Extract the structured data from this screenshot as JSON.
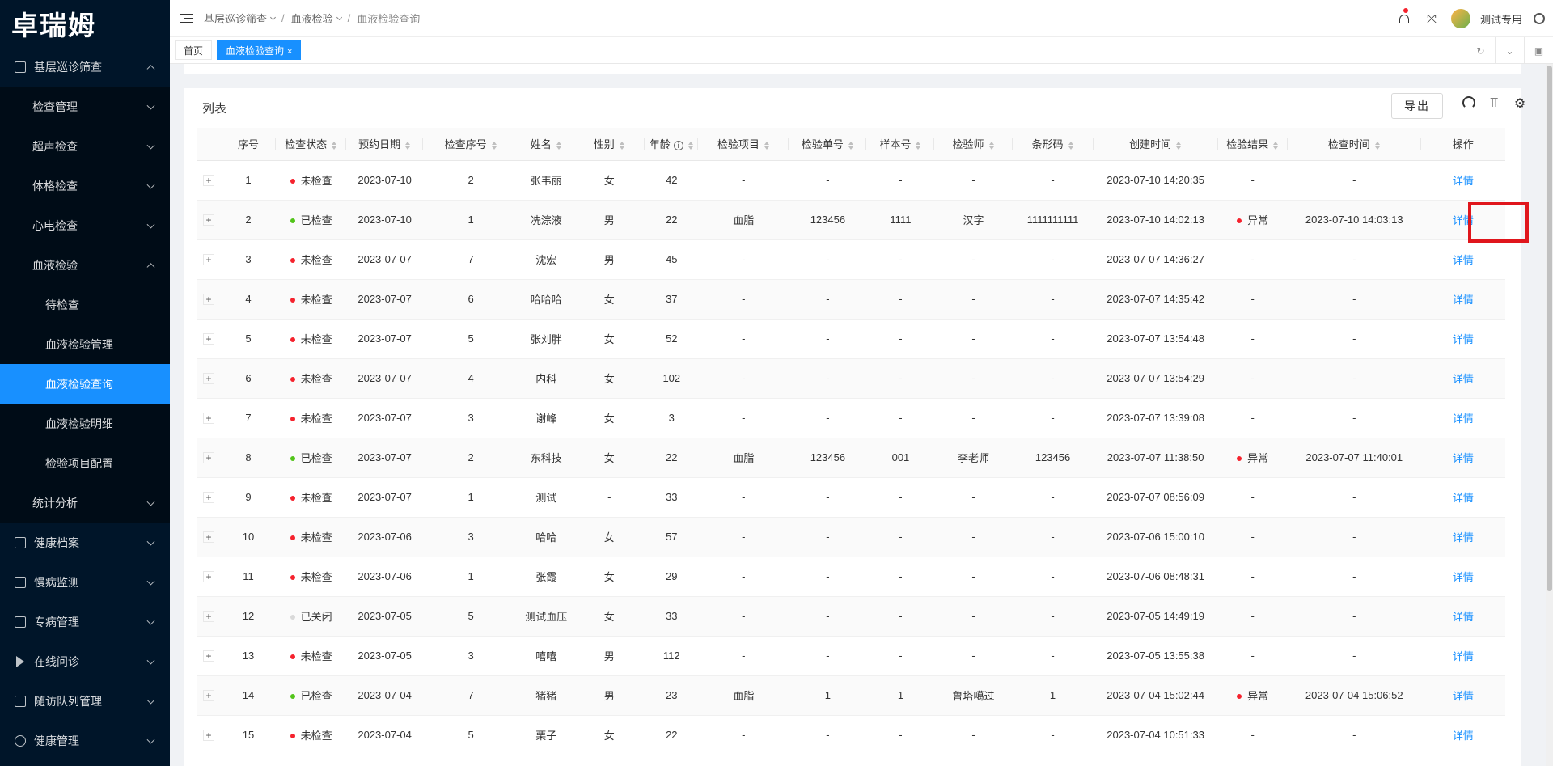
{
  "app": {
    "logo": "卓瑞姆"
  },
  "sidebar": {
    "items": [
      {
        "label": "基层巡诊筛查",
        "level": "top",
        "expanded": true,
        "icon": "dashboard-icon"
      },
      {
        "label": "检查管理",
        "level": "sub",
        "expanded": false
      },
      {
        "label": "超声检查",
        "level": "sub",
        "expanded": false
      },
      {
        "label": "体格检查",
        "level": "sub",
        "expanded": false
      },
      {
        "label": "心电检查",
        "level": "sub",
        "expanded": false
      },
      {
        "label": "血液检验",
        "level": "sub",
        "expanded": true
      },
      {
        "label": "待检查",
        "level": "sub2"
      },
      {
        "label": "血液检验管理",
        "level": "sub2"
      },
      {
        "label": "血液检验查询",
        "level": "sub2",
        "active": true
      },
      {
        "label": "血液检验明细",
        "level": "sub2"
      },
      {
        "label": "检验项目配置",
        "level": "sub2"
      },
      {
        "label": "统计分析",
        "level": "sub",
        "expanded": false
      },
      {
        "label": "健康档案",
        "level": "top",
        "expanded": false,
        "icon": "profile-icon"
      },
      {
        "label": "慢病监测",
        "level": "top",
        "expanded": false,
        "icon": "monitor-icon"
      },
      {
        "label": "专病管理",
        "level": "top",
        "expanded": false,
        "icon": "disease-icon"
      },
      {
        "label": "在线问诊",
        "level": "top",
        "expanded": false,
        "icon": "send-icon"
      },
      {
        "label": "随访队列管理",
        "level": "top",
        "expanded": false,
        "icon": "queue-icon"
      },
      {
        "label": "健康管理",
        "level": "top",
        "expanded": false,
        "icon": "shield-icon"
      }
    ]
  },
  "header": {
    "breadcrumb": [
      "基层巡诊筛查",
      "血液检验",
      "血液检验查询"
    ],
    "username": "测试专用"
  },
  "tabs": [
    {
      "label": "首页",
      "active": false
    },
    {
      "label": "血液检验查询",
      "active": true,
      "close": "×"
    }
  ],
  "list": {
    "title": "列表",
    "export_label": "导出",
    "columns": [
      "",
      "序号",
      "检查状态",
      "预约日期",
      "检查序号",
      "姓名",
      "性别",
      "年龄",
      "检验项目",
      "检验单号",
      "样本号",
      "检验师",
      "条形码",
      "创建时间",
      "检验结果",
      "检查时间",
      "操作"
    ],
    "expand_symbol": "+",
    "action_label": "详情",
    "rows": [
      {
        "no": "1",
        "status": "未检查",
        "status_color": "#f5222d",
        "date": "2023-07-10",
        "seq": "2",
        "name": "张韦丽",
        "sex": "女",
        "age": "42",
        "item": "-",
        "order": "-",
        "sample": "-",
        "tech": "-",
        "barcode": "-",
        "created": "2023-07-10 14:20:35",
        "result": "-",
        "result_color": "",
        "checked": "-"
      },
      {
        "no": "2",
        "status": "已检查",
        "status_color": "#52c41a",
        "date": "2023-07-10",
        "seq": "1",
        "name": "冼淙液",
        "sex": "男",
        "age": "22",
        "item": "血脂",
        "order": "123456",
        "sample": "1111",
        "tech": "汉字",
        "barcode": "1111111111",
        "created": "2023-07-10 14:02:13",
        "result": "异常",
        "result_color": "#f5222d",
        "checked": "2023-07-10 14:03:13"
      },
      {
        "no": "3",
        "status": "未检查",
        "status_color": "#f5222d",
        "date": "2023-07-07",
        "seq": "7",
        "name": "沈宏",
        "sex": "男",
        "age": "45",
        "item": "-",
        "order": "-",
        "sample": "-",
        "tech": "-",
        "barcode": "-",
        "created": "2023-07-07 14:36:27",
        "result": "-",
        "result_color": "",
        "checked": "-"
      },
      {
        "no": "4",
        "status": "未检查",
        "status_color": "#f5222d",
        "date": "2023-07-07",
        "seq": "6",
        "name": "哈哈哈",
        "sex": "女",
        "age": "37",
        "item": "-",
        "order": "-",
        "sample": "-",
        "tech": "-",
        "barcode": "-",
        "created": "2023-07-07 14:35:42",
        "result": "-",
        "result_color": "",
        "checked": "-"
      },
      {
        "no": "5",
        "status": "未检查",
        "status_color": "#f5222d",
        "date": "2023-07-07",
        "seq": "5",
        "name": "张刘胖",
        "sex": "女",
        "age": "52",
        "item": "-",
        "order": "-",
        "sample": "-",
        "tech": "-",
        "barcode": "-",
        "created": "2023-07-07 13:54:48",
        "result": "-",
        "result_color": "",
        "checked": "-"
      },
      {
        "no": "6",
        "status": "未检查",
        "status_color": "#f5222d",
        "date": "2023-07-07",
        "seq": "4",
        "name": "内科",
        "sex": "女",
        "age": "102",
        "item": "-",
        "order": "-",
        "sample": "-",
        "tech": "-",
        "barcode": "-",
        "created": "2023-07-07 13:54:29",
        "result": "-",
        "result_color": "",
        "checked": "-"
      },
      {
        "no": "7",
        "status": "未检查",
        "status_color": "#f5222d",
        "date": "2023-07-07",
        "seq": "3",
        "name": "谢峰",
        "sex": "女",
        "age": "3",
        "item": "-",
        "order": "-",
        "sample": "-",
        "tech": "-",
        "barcode": "-",
        "created": "2023-07-07 13:39:08",
        "result": "-",
        "result_color": "",
        "checked": "-"
      },
      {
        "no": "8",
        "status": "已检查",
        "status_color": "#52c41a",
        "date": "2023-07-07",
        "seq": "2",
        "name": "东科技",
        "sex": "女",
        "age": "22",
        "item": "血脂",
        "order": "123456",
        "sample": "001",
        "tech": "李老师",
        "barcode": "123456",
        "created": "2023-07-07 11:38:50",
        "result": "异常",
        "result_color": "#f5222d",
        "checked": "2023-07-07 11:40:01"
      },
      {
        "no": "9",
        "status": "未检查",
        "status_color": "#f5222d",
        "date": "2023-07-07",
        "seq": "1",
        "name": "测试",
        "sex": "-",
        "age": "33",
        "item": "-",
        "order": "-",
        "sample": "-",
        "tech": "-",
        "barcode": "-",
        "created": "2023-07-07 08:56:09",
        "result": "-",
        "result_color": "",
        "checked": "-"
      },
      {
        "no": "10",
        "status": "未检查",
        "status_color": "#f5222d",
        "date": "2023-07-06",
        "seq": "3",
        "name": "哈哈",
        "sex": "女",
        "age": "57",
        "item": "-",
        "order": "-",
        "sample": "-",
        "tech": "-",
        "barcode": "-",
        "created": "2023-07-06 15:00:10",
        "result": "-",
        "result_color": "",
        "checked": "-"
      },
      {
        "no": "11",
        "status": "未检查",
        "status_color": "#f5222d",
        "date": "2023-07-06",
        "seq": "1",
        "name": "张霞",
        "sex": "女",
        "age": "29",
        "item": "-",
        "order": "-",
        "sample": "-",
        "tech": "-",
        "barcode": "-",
        "created": "2023-07-06 08:48:31",
        "result": "-",
        "result_color": "",
        "checked": "-"
      },
      {
        "no": "12",
        "status": "已关闭",
        "status_color": "#d9d9d9",
        "date": "2023-07-05",
        "seq": "5",
        "name": "测试血压",
        "sex": "女",
        "age": "33",
        "item": "-",
        "order": "-",
        "sample": "-",
        "tech": "-",
        "barcode": "-",
        "created": "2023-07-05 14:49:19",
        "result": "-",
        "result_color": "",
        "checked": "-"
      },
      {
        "no": "13",
        "status": "未检查",
        "status_color": "#f5222d",
        "date": "2023-07-05",
        "seq": "3",
        "name": "嘻嘻",
        "sex": "男",
        "age": "112",
        "item": "-",
        "order": "-",
        "sample": "-",
        "tech": "-",
        "barcode": "-",
        "created": "2023-07-05 13:55:38",
        "result": "-",
        "result_color": "",
        "checked": "-"
      },
      {
        "no": "14",
        "status": "已检查",
        "status_color": "#52c41a",
        "date": "2023-07-04",
        "seq": "7",
        "name": "猪猪",
        "sex": "男",
        "age": "23",
        "item": "血脂",
        "order": "1",
        "sample": "1",
        "tech": "鲁塔噶过",
        "barcode": "1",
        "created": "2023-07-04 15:02:44",
        "result": "异常",
        "result_color": "#f5222d",
        "checked": "2023-07-04 15:06:52"
      },
      {
        "no": "15",
        "status": "未检查",
        "status_color": "#f5222d",
        "date": "2023-07-04",
        "seq": "5",
        "name": "栗子",
        "sex": "女",
        "age": "22",
        "item": "-",
        "order": "-",
        "sample": "-",
        "tech": "-",
        "barcode": "-",
        "created": "2023-07-04 10:51:33",
        "result": "-",
        "result_color": "",
        "checked": "-"
      }
    ]
  }
}
